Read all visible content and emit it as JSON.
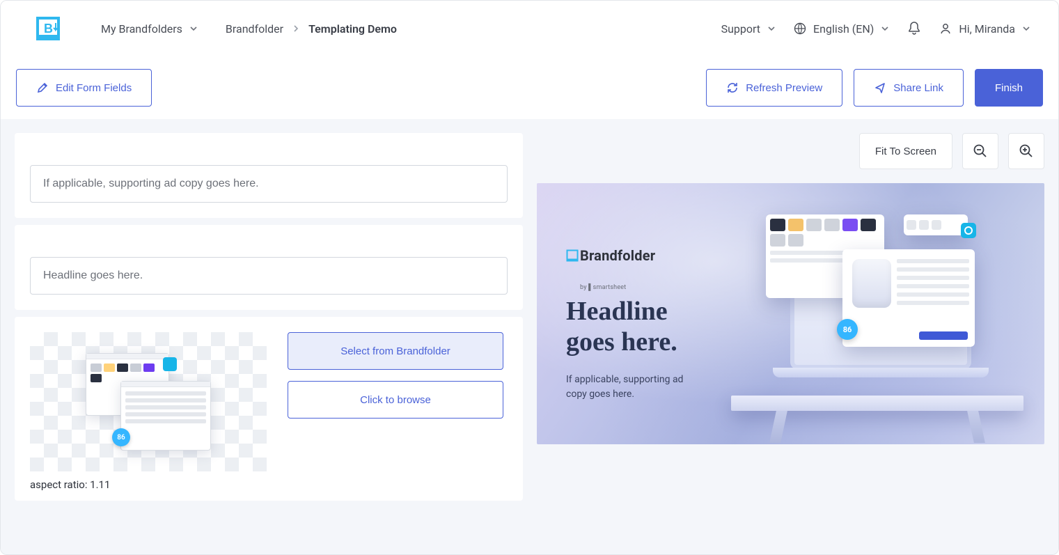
{
  "nav": {
    "my_brandfolders": "My Brandfolders",
    "breadcrumb_parent": "Brandfolder",
    "breadcrumb_current": "Templating Demo",
    "support": "Support",
    "language": "English (EN)",
    "greeting": "Hi, Miranda"
  },
  "actions": {
    "edit_form_fields": "Edit Form Fields",
    "refresh_preview": "Refresh Preview",
    "share_link": "Share Link",
    "finish": "Finish"
  },
  "form": {
    "supporting_placeholder": "If applicable, supporting ad copy goes here.",
    "headline_placeholder": "Headline goes here.",
    "select_from_brandfolder": "Select from Brandfolder",
    "click_to_browse": "Click to browse",
    "aspect_ratio_label": "aspect ratio: 1.11",
    "thumb_badge": "86"
  },
  "preview_tools": {
    "fit_to_screen": "Fit To Screen"
  },
  "preview": {
    "logo_word": "Brandfolder",
    "logo_sub": "by ▌smartsheet",
    "headline": "Headline\ngoes here.",
    "subcopy": "If applicable, supporting ad\ncopy goes here.",
    "badge": "86"
  }
}
